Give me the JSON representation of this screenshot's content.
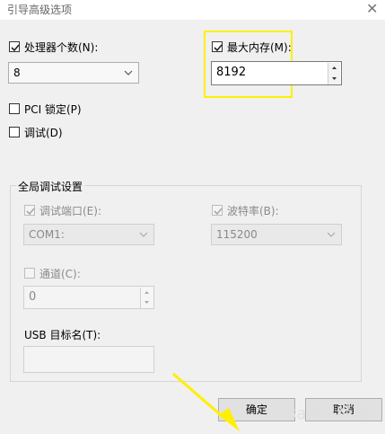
{
  "window": {
    "title": "引导高级选项",
    "close_glyph": "✕"
  },
  "processor_count": {
    "label": "处理器个数(N):",
    "checked": true,
    "value": "8"
  },
  "max_memory": {
    "label": "最大内存(M):",
    "checked": true,
    "value": "8192"
  },
  "pci_lock": {
    "label": "PCI 锁定(P)",
    "checked": false
  },
  "debug": {
    "label": "调试(D)",
    "checked": false
  },
  "global_debug": {
    "group_label": "全局调试设置",
    "debug_port": {
      "label": "调试端口(E):",
      "checked": true,
      "value": "COM1:"
    },
    "baud_rate": {
      "label": "波特率(B):",
      "checked": true,
      "value": "115200"
    },
    "channel": {
      "label": "通道(C):",
      "checked": false,
      "value": "0"
    },
    "usb_target": {
      "label": "USB 目标名(T):",
      "value": ""
    }
  },
  "buttons": {
    "ok": "确定",
    "cancel": "取消"
  },
  "watermark": {
    "text": "Baidu 经验"
  },
  "colors": {
    "highlight": "#ffef00",
    "annotation_arrow": "#ffef00"
  }
}
